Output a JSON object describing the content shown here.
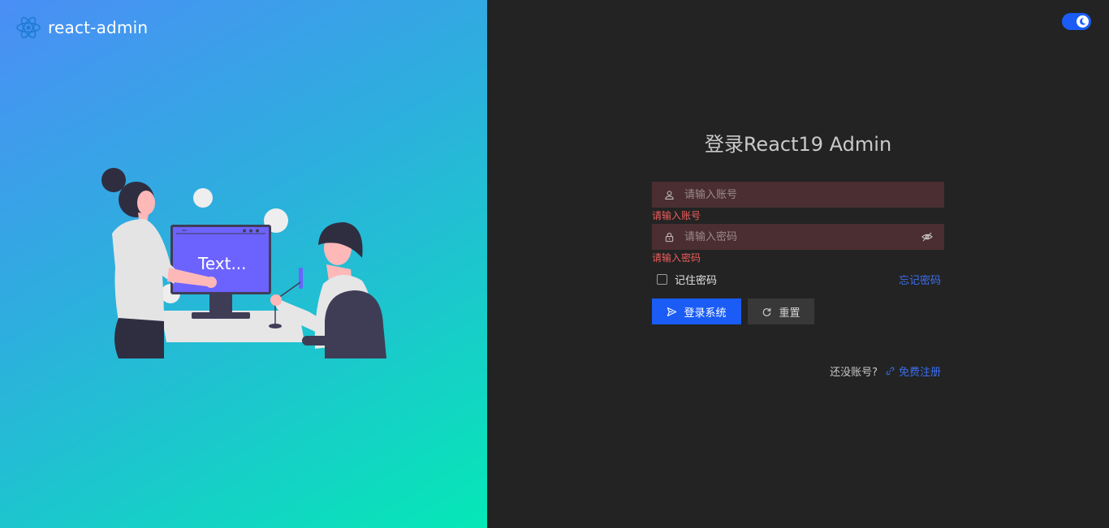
{
  "brand": {
    "name": "react-admin",
    "logo_icon": "react-atom-icon"
  },
  "illustration": {
    "screen_text": "Text..."
  },
  "theme_toggle": {
    "icon": "moon-icon",
    "state": "dark"
  },
  "login": {
    "title": "登录React19 Admin",
    "username": {
      "placeholder": "请输入账号",
      "value": "",
      "error": "请输入账号",
      "icon": "user-icon"
    },
    "password": {
      "placeholder": "请输入密码",
      "value": "",
      "error": "请输入密码",
      "icon": "lock-icon",
      "toggle_icon": "eye-off-icon"
    },
    "remember_label": "记住密码",
    "remember_checked": false,
    "forgot_label": "忘记密码",
    "submit_label": "登录系统",
    "reset_label": "重置",
    "no_account_text": "还没账号?",
    "register_label": "免费注册"
  },
  "colors": {
    "accent": "#1a5cf5",
    "error": "#f05c5c",
    "link": "#3a6ff2",
    "panel_dark": "#232323",
    "gradient_start": "#4b8ef6",
    "gradient_end": "#05e8b6"
  }
}
